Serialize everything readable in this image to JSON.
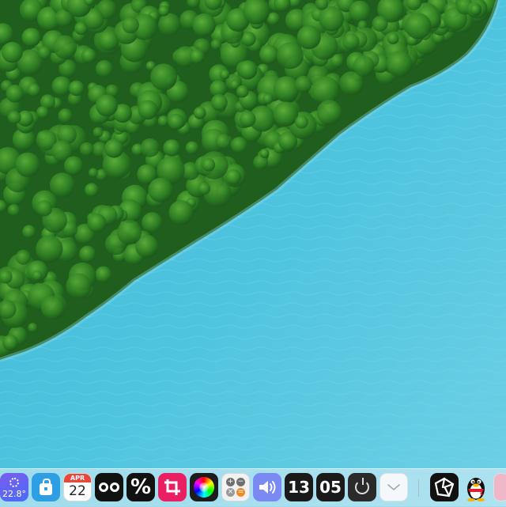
{
  "dock": {
    "weather": {
      "temperature": "22.8°",
      "icon": "sun-icon"
    },
    "store": {
      "icon": "shopping-bag-icon"
    },
    "calendar": {
      "month": "APR",
      "day": "22"
    },
    "owl": {
      "icon": "owl-eyes-icon"
    },
    "percent": {
      "glyph": "%"
    },
    "crop": {
      "icon": "crop-icon"
    },
    "colorwheel": {
      "icon": "color-wheel-icon"
    },
    "calculator": {
      "keys": [
        "+",
        "−",
        "×",
        "="
      ]
    },
    "volume": {
      "icon": "speaker-icon"
    },
    "clock": {
      "hour": "13",
      "minute": "05"
    },
    "power": {
      "icon": "power-icon"
    },
    "expand": {
      "icon": "chevron-down-icon"
    },
    "aperture": {
      "icon": "aperture-icon"
    },
    "qq": {
      "icon": "penguin-icon"
    }
  },
  "colors": {
    "water": "#4fc3dc",
    "forest": "#2f7d24",
    "accent_red": "#e8473c",
    "crop_pink": "#ea1f63",
    "volume_purple": "#7b8af2"
  }
}
